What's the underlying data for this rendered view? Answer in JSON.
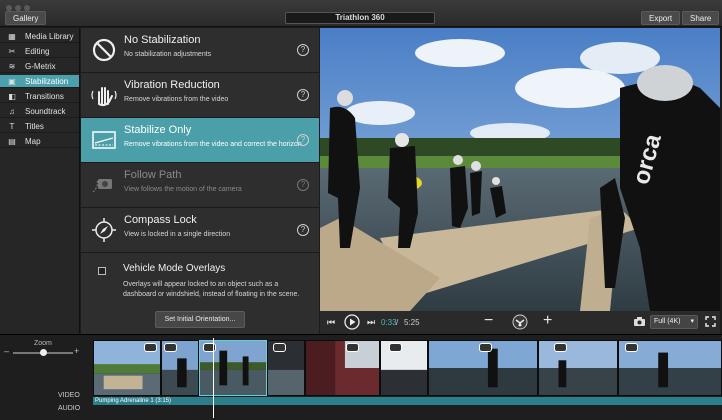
{
  "window": {
    "gallery_button": "Gallery",
    "project_title": "Triathlon 360",
    "export_button": "Export",
    "share_button": "Share"
  },
  "sidebar": {
    "items": [
      {
        "label": "Media Library",
        "icon": "film-icon",
        "glyph": "▦"
      },
      {
        "label": "Editing",
        "icon": "scissors-icon",
        "glyph": "✂"
      },
      {
        "label": "G-Metrix",
        "icon": "gmetrix-icon",
        "glyph": "≋"
      },
      {
        "label": "Stabilization",
        "icon": "stabilization-icon",
        "glyph": "▣"
      },
      {
        "label": "Transitions",
        "icon": "transitions-icon",
        "glyph": "◧"
      },
      {
        "label": "Soundtrack",
        "icon": "music-note-icon",
        "glyph": "♫"
      },
      {
        "label": "Titles",
        "icon": "titles-icon",
        "glyph": "T"
      },
      {
        "label": "Map",
        "icon": "map-icon",
        "glyph": "▤"
      }
    ],
    "active_index": 3
  },
  "stabilization": {
    "options": [
      {
        "title": "No Stabilization",
        "desc": "No stabilization adjustments",
        "icon": "no-stabilization-icon",
        "state": "normal"
      },
      {
        "title": "Vibration Reduction",
        "desc": "Remove vibrations from the video",
        "icon": "hand-vibration-icon",
        "state": "normal"
      },
      {
        "title": "Stabilize Only",
        "desc": "Remove vibrations from the video and correct the horizon",
        "icon": "horizon-icon",
        "state": "active"
      },
      {
        "title": "Follow Path",
        "desc": "View follows the motion of the camera",
        "icon": "camera-path-icon",
        "state": "disabled"
      },
      {
        "title": "Compass Lock",
        "desc": "View is locked in a single direction",
        "icon": "compass-icon",
        "state": "normal"
      }
    ],
    "help_glyph": "?",
    "vehicle": {
      "title": "Vehicle Mode Overlays",
      "desc": "Overlays will appear locked to an object such as a dashboard or windshield, instead of floating in the scene.",
      "checked": false
    },
    "init_orientation_button": "Set Initial Orientation..."
  },
  "player": {
    "current_time": "0:33",
    "separator": "/",
    "total_time": "5:25",
    "resolution": "Full (4K)",
    "video_text": "orca"
  },
  "timeline": {
    "zoom_label": "Zoom",
    "zoom_minus": "–",
    "zoom_plus": "+",
    "zoom_level": 0.5,
    "video_track_label": "VIDEO",
    "audio_track_label": "AUDIO",
    "audio_clip": "Pumping Adrenaline 1  (3:15)"
  },
  "colors": {
    "accent": "#4aa1ad",
    "time_current": "#4ab7c4",
    "audio_track": "#2b7f8b"
  }
}
